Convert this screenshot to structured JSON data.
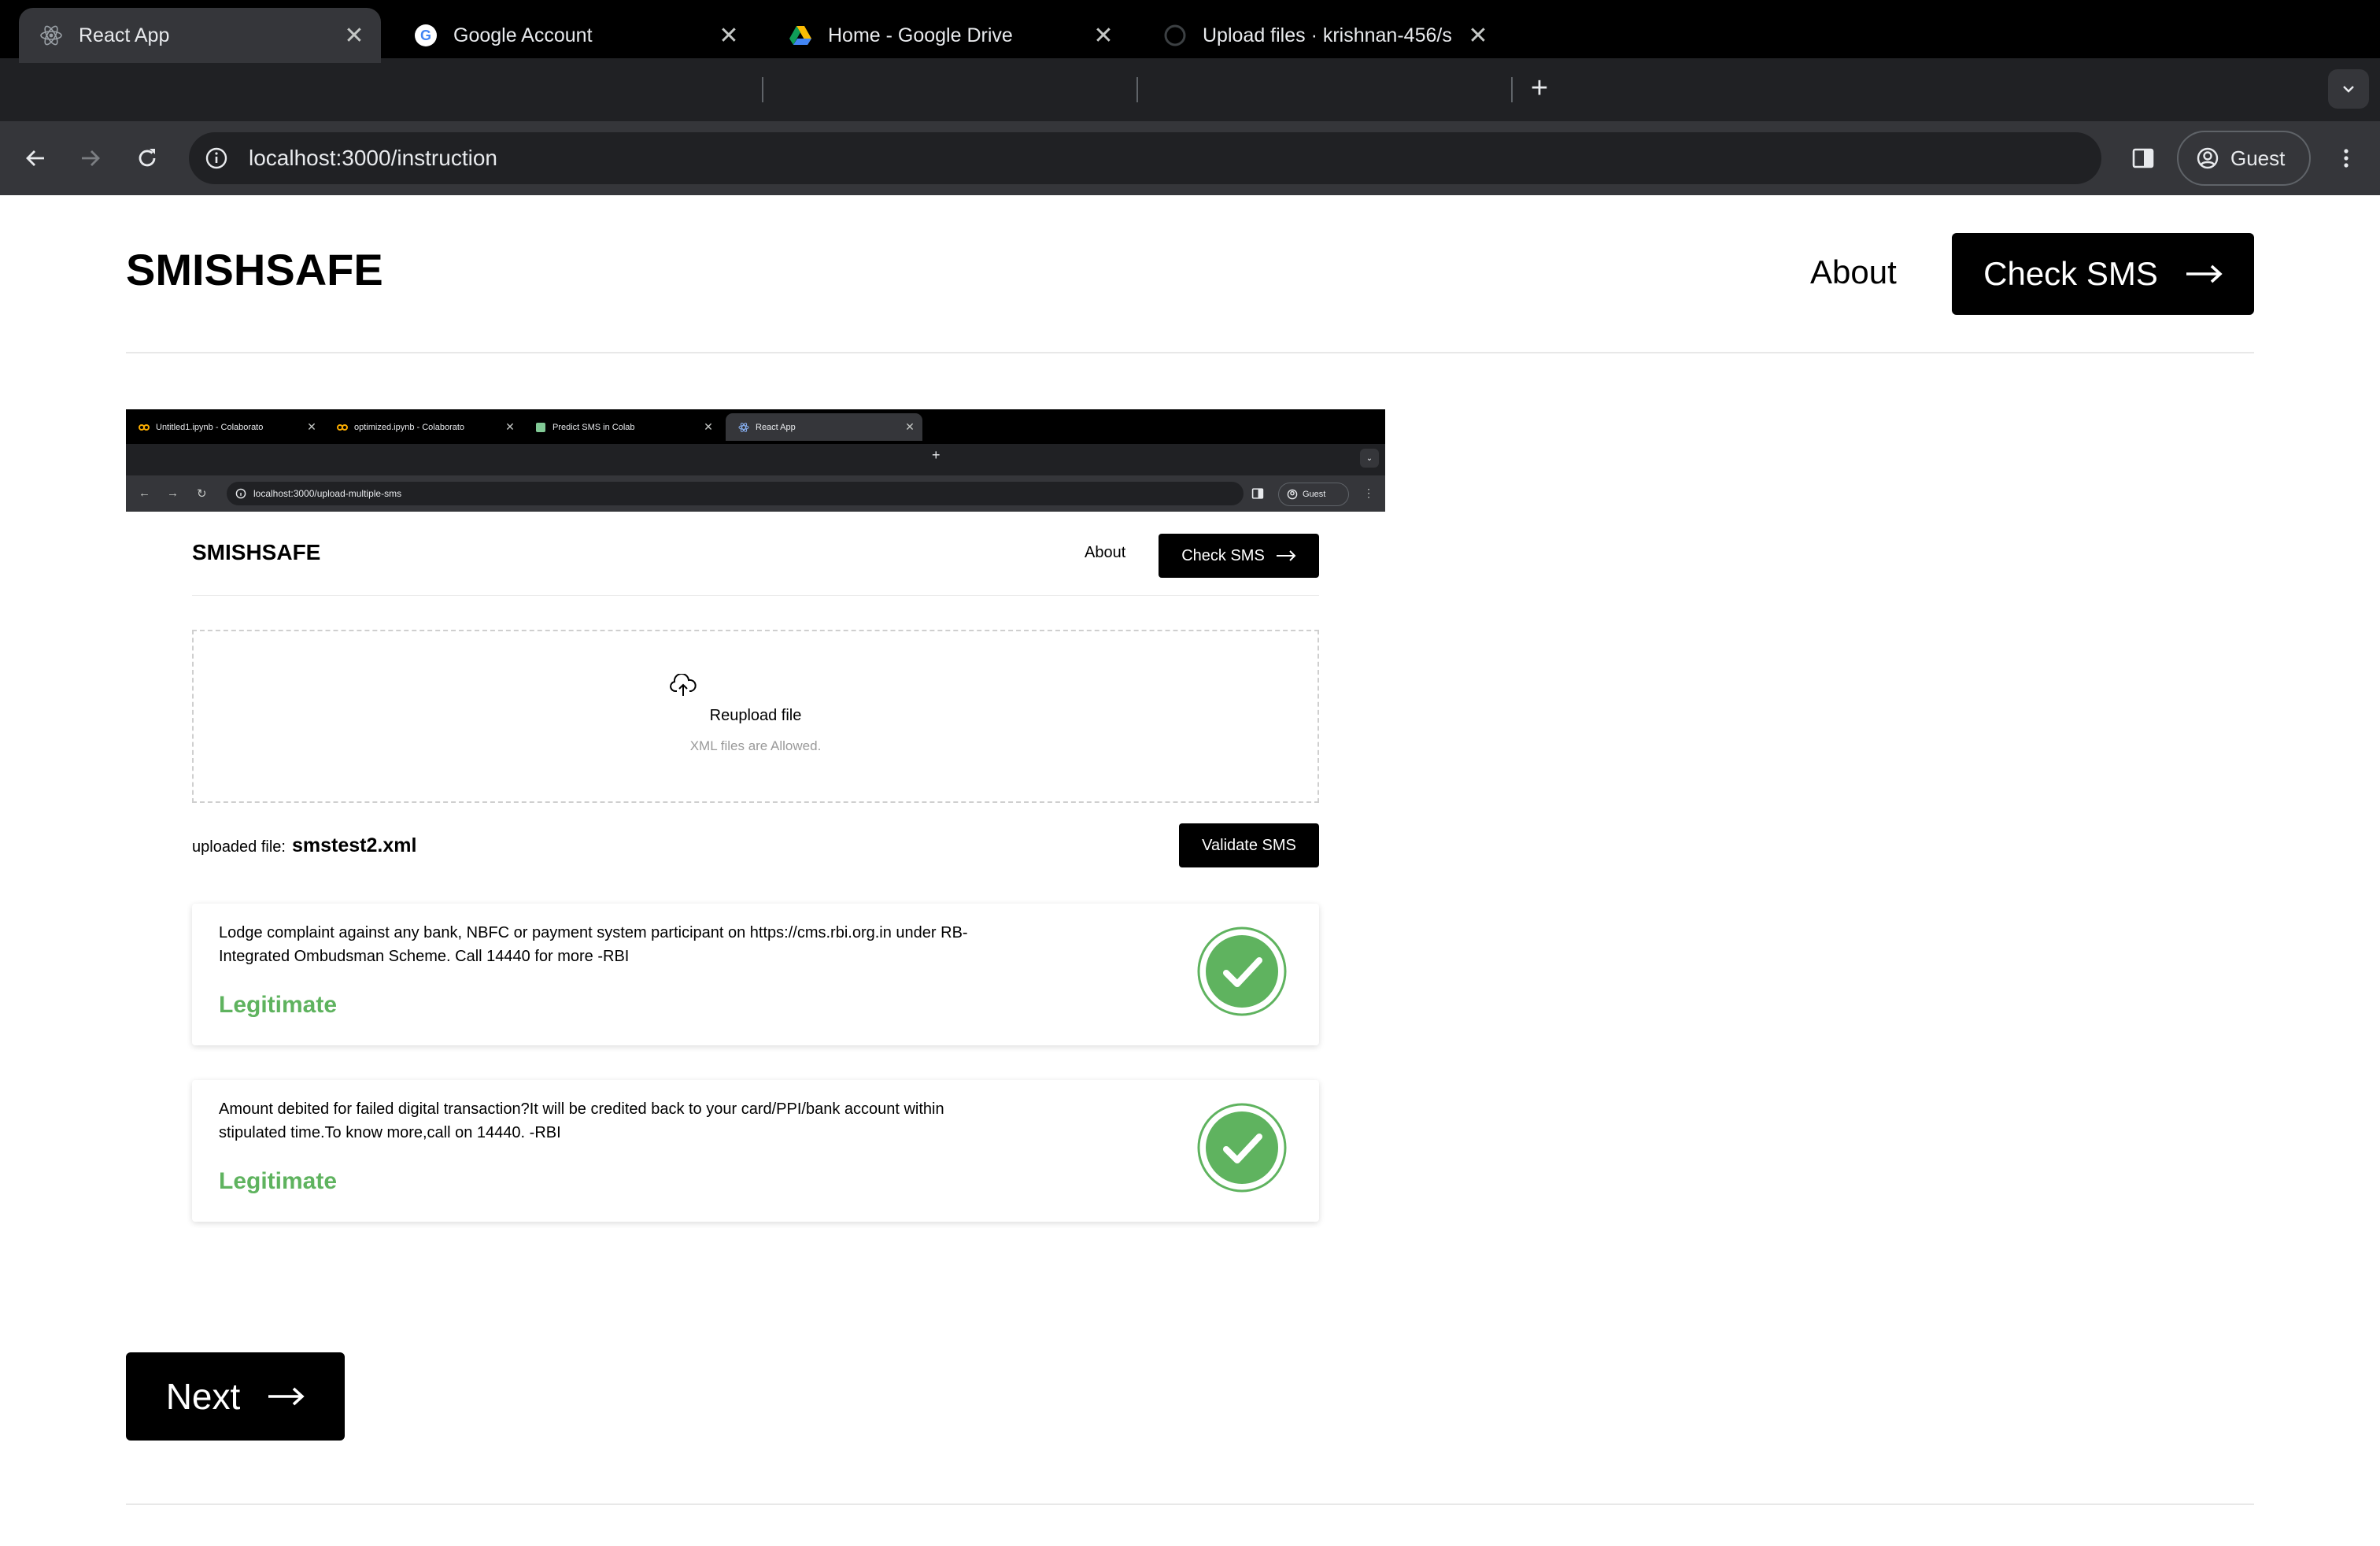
{
  "browser": {
    "tabs": [
      {
        "title": "React App",
        "active": true,
        "icon": "react-icon"
      },
      {
        "title": "Google Account",
        "active": false,
        "icon": "google-icon"
      },
      {
        "title": "Home - Google Drive",
        "active": false,
        "icon": "google-drive-icon"
      },
      {
        "title": "Upload files · krishnan-456/s",
        "active": false,
        "icon": "github-icon"
      }
    ],
    "url": "localhost:3000/instruction",
    "profile_label": "Guest"
  },
  "header": {
    "logo": "SMISHSAFE",
    "about_label": "About",
    "check_sms_label": "Check SMS"
  },
  "screenshot": {
    "tabs": [
      {
        "title": "Untitled1.ipynb - Colaborato",
        "active": false,
        "icon": "colab-icon"
      },
      {
        "title": "optimized.ipynb - Colaborato",
        "active": false,
        "icon": "colab-icon"
      },
      {
        "title": "Predict SMS in Colab",
        "active": false,
        "icon": "page-icon"
      },
      {
        "title": "React App",
        "active": true,
        "icon": "react-icon"
      }
    ],
    "url": "localhost:3000/upload-multiple-sms",
    "profile_label": "Guest",
    "logo": "SMISHSAFE",
    "about_label": "About",
    "check_sms_label": "Check SMS",
    "reupload_label": "Reupload file",
    "allowed_text": "XML files are Allowed.",
    "uploaded_prefix": "uploaded file:",
    "uploaded_filename": "smstest2.xml",
    "validate_label": "Validate SMS",
    "results": [
      {
        "message": "Lodge complaint against any bank, NBFC or payment system participant on https://cms.rbi.org.in under RB-Integrated Ombudsman Scheme. Call 14440 for more -RBI",
        "label": "Legitimate"
      },
      {
        "message": "Amount debited for failed digital transaction?It will be credited back to your card/PPI/bank account within stipulated time.To know more,call on 14440. -RBI",
        "label": "Legitimate"
      }
    ]
  },
  "footer": {
    "next_label": "Next"
  },
  "colors": {
    "legit_green": "#5fb35f",
    "button_black": "#000000",
    "chrome_dark": "#202124",
    "chrome_toolbar": "#35363a"
  }
}
